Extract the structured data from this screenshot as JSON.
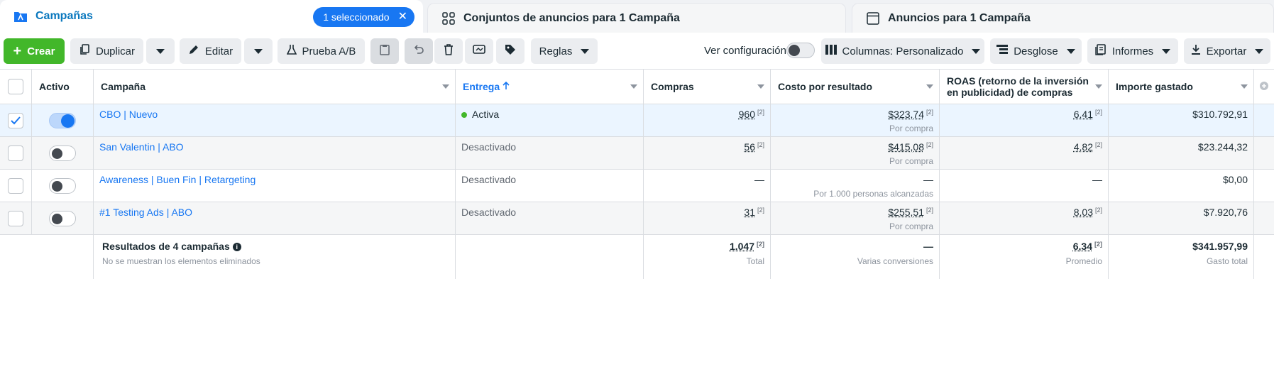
{
  "tabs": {
    "campaigns": "Campañas",
    "selected_badge": "1 seleccionado",
    "adsets": "Conjuntos de anuncios para 1 Campaña",
    "ads": "Anuncios para 1 Campaña"
  },
  "toolbar": {
    "create": "Crear",
    "duplicate": "Duplicar",
    "edit": "Editar",
    "ab_test": "Prueba A/B",
    "rules": "Reglas",
    "view_config": "Ver configuración",
    "columns": "Columnas: Personalizado",
    "breakdown": "Desglose",
    "reports": "Informes",
    "export": "Exportar"
  },
  "columns": {
    "active": "Activo",
    "campaign": "Campaña",
    "delivery": "Entrega",
    "purchases": "Compras",
    "cost_per_result": "Costo por resultado",
    "roas_line1": "ROAS (retorno de la inversión",
    "roas_line2": "en publicidad) de compras",
    "amount_spent": "Importe gastado"
  },
  "rows": [
    {
      "name": "CBO | Nuevo",
      "delivery": "Activa",
      "purchases": "960",
      "purchases_note": "[2]",
      "cost": "$323,74",
      "cost_note": "[2]",
      "cost_sub": "Por compra",
      "roas": "6,41",
      "roas_note": "[2]",
      "spent": "$310.792,91"
    },
    {
      "name": "San Valentin | ABO",
      "delivery": "Desactivado",
      "purchases": "56",
      "purchases_note": "[2]",
      "cost": "$415,08",
      "cost_note": "[2]",
      "cost_sub": "Por compra",
      "roas": "4,82",
      "roas_note": "[2]",
      "spent": "$23.244,32"
    },
    {
      "name": "Awareness | Buen Fin | Retargeting",
      "delivery": "Desactivado",
      "purchases": "—",
      "cost": "—",
      "cost_sub": "Por 1.000 personas alcanzadas",
      "roas": "—",
      "spent": "$0,00"
    },
    {
      "name": "#1 Testing Ads | ABO",
      "delivery": "Desactivado",
      "purchases": "31",
      "purchases_note": "[2]",
      "cost": "$255,51",
      "cost_note": "[2]",
      "cost_sub": "Por compra",
      "roas": "8,03",
      "roas_note": "[2]",
      "spent": "$7.920,76"
    }
  ],
  "totals": {
    "title": "Resultados de 4 campañas",
    "subtitle": "No se muestran los elementos eliminados",
    "purchases": "1.047",
    "purchases_note": "[2]",
    "purchases_sub": "Total",
    "cost": "—",
    "cost_sub": "Varias conversiones",
    "roas": "6,34",
    "roas_note": "[2]",
    "roas_sub": "Promedio",
    "spent": "$341.957,99",
    "spent_sub": "Gasto total"
  }
}
